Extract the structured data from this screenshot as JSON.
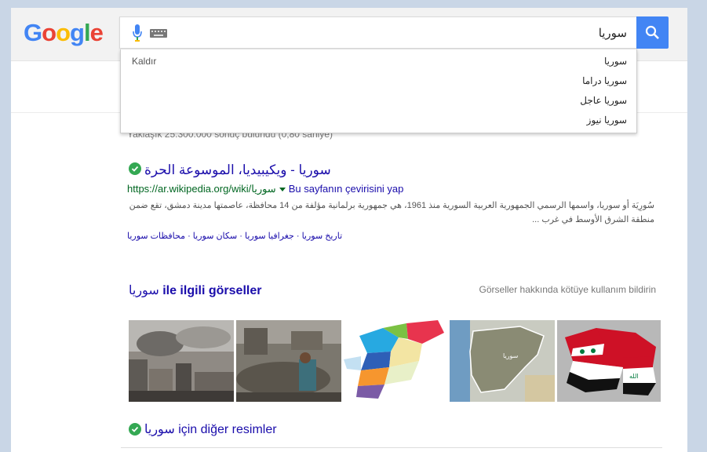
{
  "logo": {
    "letters": [
      "G",
      "o",
      "o",
      "g",
      "l",
      "e"
    ],
    "colors": [
      "#4285f4",
      "#ea4335",
      "#fbbc05",
      "#4285f4",
      "#34a853",
      "#ea4335"
    ]
  },
  "search": {
    "query": "سوريا",
    "mic_icon": "microphone-icon",
    "keyboard_icon": "keyboard-icon",
    "button_icon": "search-icon"
  },
  "suggestions": {
    "remove_label": "Kaldır",
    "items": [
      "سوريا",
      "سوريا دراما",
      "سوريا عاجل",
      "سوريا نيوز"
    ]
  },
  "results": {
    "stats": "Yaklaşık 25.300.000 sonuç bulundu (0,80 saniye)",
    "first": {
      "title": "سوريا - ويكيبيديا، الموسوعة الحرة",
      "url": "https://ar.wikipedia.org/wiki/سوريا",
      "translate_label": "Bu sayfanın çevirisini yap",
      "snippet": "سُورِيَة أو سوريا، واسمها الرسمي الجمهورية العربية السورية منذ 1961، هي جمهورية برلمانية مؤلفة من 14 محافظة، عاصمتها مدينة دمشق، تقع ضمن منطقة الشرق الأوسط في غرب ...",
      "sitelinks": "تاريخ سوريا · جغرافيا سوريا · سكان سوريا · محافظات سوريا"
    }
  },
  "images_block": {
    "heading_query": "سوريا",
    "heading_suffix": "ile ilgili görseller",
    "report_label": "Görseller hakkında kötüye kullanım bildirin",
    "more_query": "سوريا",
    "more_suffix": "için diğer resimler"
  }
}
